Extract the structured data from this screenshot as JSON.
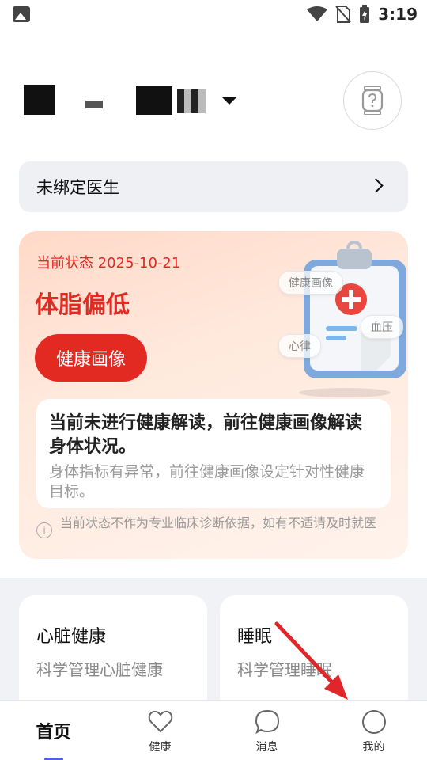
{
  "status_bar": {
    "time": "3:19"
  },
  "header": {
    "account_label": ""
  },
  "doctor_bar": {
    "label": "未绑定医生"
  },
  "status_card": {
    "date_label": "当前状态 2025-10-21",
    "status": "体脂偏低",
    "button_label": "健康画像",
    "illustration_tags": [
      "健康画像",
      "血压",
      "心律"
    ],
    "info_title": "当前未进行健康解读，前往健康画像解读身体状况。",
    "info_subtitle": "身体指标有异常，前往健康画像设定针对性健康目标。",
    "disclaimer": "当前状态不作为专业临床诊断依据，如有不适请及时就医"
  },
  "modules": [
    {
      "title": "心脏健康",
      "subtitle": "科学管理心脏健康"
    },
    {
      "title": "睡眠",
      "subtitle": "科学管理睡眠"
    }
  ],
  "tabs": [
    {
      "label": "首页",
      "icon": "home"
    },
    {
      "label": "健康",
      "icon": "heart-icon"
    },
    {
      "label": "消息",
      "icon": "chat-bubble-icon"
    },
    {
      "label": "我的",
      "icon": "profile-circle-icon"
    }
  ],
  "colors": {
    "accent_red": "#e32a22",
    "tab_indicator": "#5160e3",
    "annotation_arrow": "#e0262a"
  }
}
